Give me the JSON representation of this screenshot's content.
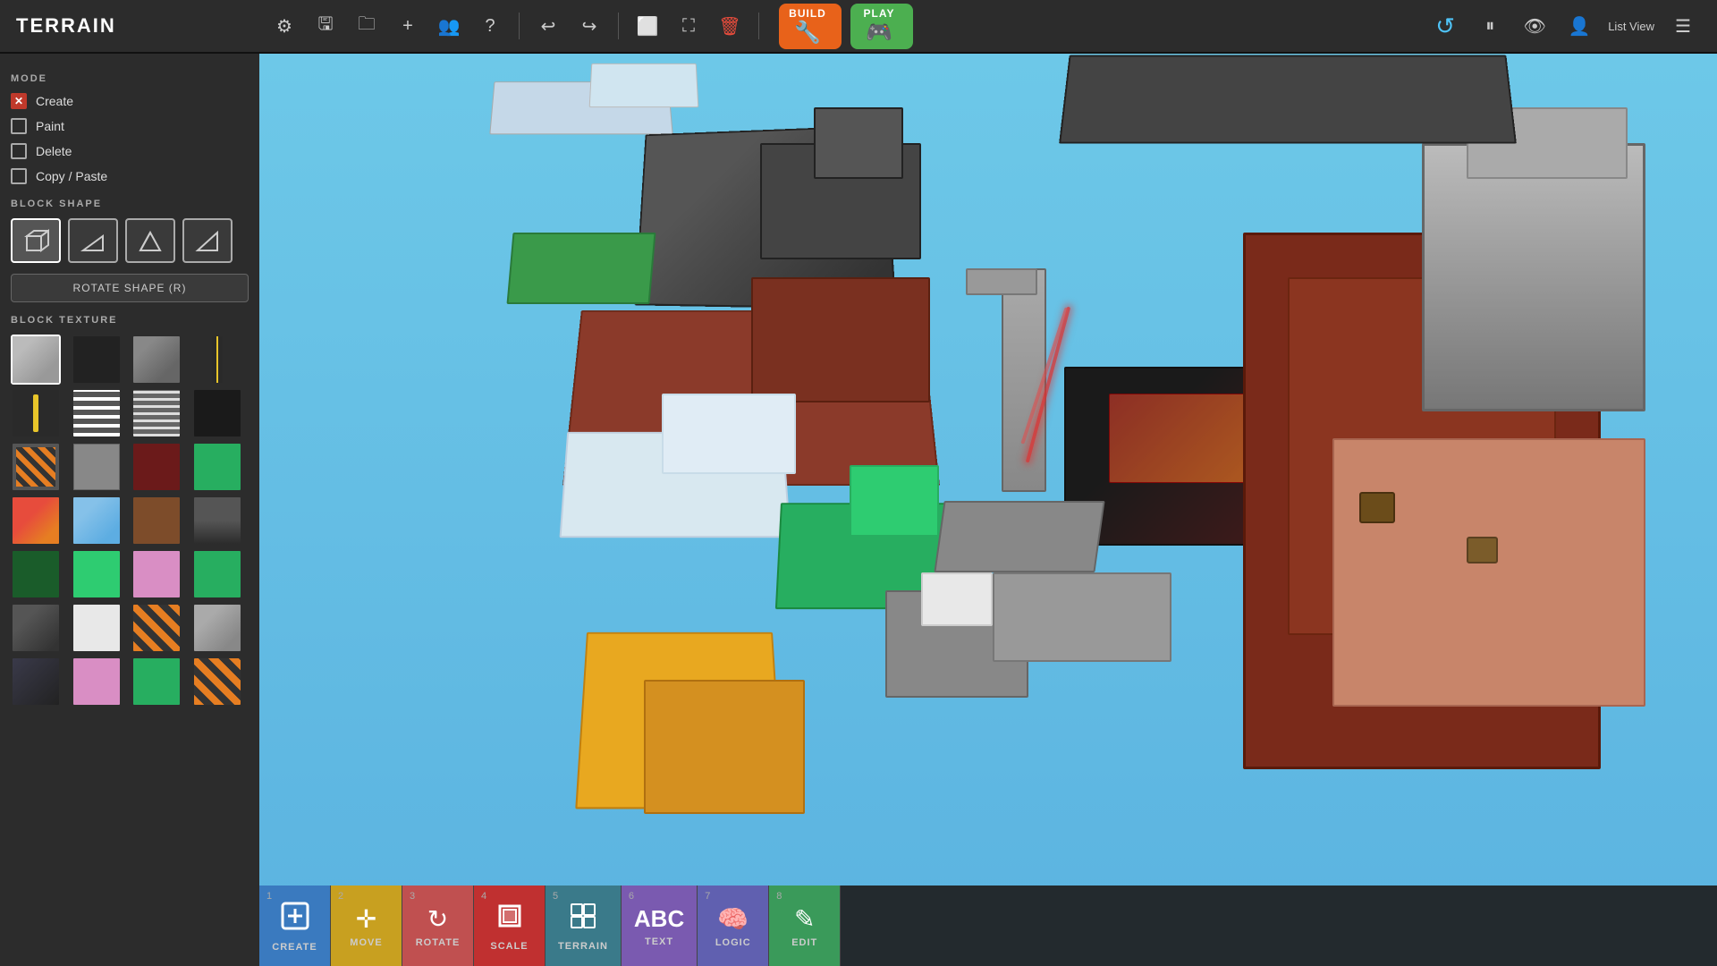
{
  "app": {
    "title": "TERRAIN"
  },
  "topbar": {
    "build_label": "BUILD",
    "play_label": "PLAY",
    "list_view_label": "List View",
    "tools": [
      {
        "name": "settings",
        "icon": "⚙",
        "label": "settings-icon"
      },
      {
        "name": "save",
        "icon": "💾",
        "label": "save-icon"
      },
      {
        "name": "folder",
        "icon": "📁",
        "label": "folder-icon"
      },
      {
        "name": "add",
        "icon": "➕",
        "label": "add-icon"
      },
      {
        "name": "team",
        "icon": "👥",
        "label": "team-icon"
      },
      {
        "name": "help",
        "icon": "❓",
        "label": "help-icon"
      },
      {
        "name": "undo",
        "icon": "↩",
        "label": "undo-icon"
      },
      {
        "name": "redo",
        "icon": "↪",
        "label": "redo-icon"
      },
      {
        "name": "copy-view",
        "icon": "⬜",
        "label": "copy-view-icon"
      },
      {
        "name": "resize",
        "icon": "⛶",
        "label": "resize-icon"
      },
      {
        "name": "trash",
        "icon": "🗑",
        "label": "trash-icon"
      }
    ],
    "right_tools": [
      {
        "name": "refresh",
        "icon": "↺",
        "label": "refresh-icon"
      },
      {
        "name": "pause",
        "icon": "⏸",
        "label": "pause-icon"
      },
      {
        "name": "eye",
        "icon": "👁",
        "label": "eye-icon"
      },
      {
        "name": "profile",
        "icon": "👤",
        "label": "profile-icon"
      }
    ]
  },
  "sidebar": {
    "mode_label": "MODE",
    "modes": [
      {
        "id": "create",
        "label": "Create",
        "active": true,
        "x_style": true
      },
      {
        "id": "paint",
        "label": "Paint",
        "active": false
      },
      {
        "id": "delete",
        "label": "Delete",
        "active": false
      },
      {
        "id": "copy-paste",
        "label": "Copy / Paste",
        "active": false
      }
    ],
    "block_shape_label": "BLOCK SHAPE",
    "shapes": [
      {
        "id": "cube",
        "icon": "⬛",
        "label": "Cube",
        "active": true
      },
      {
        "id": "slope",
        "icon": "◨",
        "label": "Slope",
        "active": false
      },
      {
        "id": "wedge",
        "icon": "◤",
        "label": "Wedge",
        "active": false
      },
      {
        "id": "corner",
        "icon": "△",
        "label": "Corner",
        "active": false
      }
    ],
    "rotate_label": "ROTATE SHAPE (R)",
    "block_texture_label": "BLOCK TEXTURE",
    "textures": [
      "t-gray-light",
      "t-dark",
      "t-gray-med",
      "t-yellow-stripe",
      "t-tall-yellow",
      "t-white-lines",
      "t-horizontal-lines",
      "t-dark2",
      "t-red-brick",
      "t-orange-warn",
      "t-cobble",
      "t-dark-red",
      "t-green",
      "t-lava",
      "t-ice",
      "t-brown",
      "t-mountain",
      "t-dark-green",
      "t-green2",
      "t-pink",
      "t-green3",
      "t-stone-dark",
      "t-snow",
      "t-striped-warn",
      "t-stone-light",
      "t-pink",
      "t-green3",
      "t-striped-warn"
    ]
  },
  "bottom_toolbar": {
    "tools": [
      {
        "num": "1",
        "icon": "⊞",
        "label": "CREATE",
        "class": "bt-create"
      },
      {
        "num": "2",
        "icon": "✛",
        "label": "MOVE",
        "class": "bt-move"
      },
      {
        "num": "3",
        "icon": "↻",
        "label": "ROTATE",
        "class": "bt-rotate"
      },
      {
        "num": "4",
        "icon": "⛓",
        "label": "SCALE",
        "class": "bt-scale"
      },
      {
        "num": "5",
        "icon": "⊞",
        "label": "TERRAIN",
        "class": "bt-terrain"
      },
      {
        "num": "6",
        "icon": "Ⓐ",
        "label": "TEXT",
        "class": "bt-text"
      },
      {
        "num": "7",
        "icon": "🧠",
        "label": "LOGIC",
        "class": "bt-logic"
      },
      {
        "num": "8",
        "icon": "✎",
        "label": "EDIT",
        "class": "bt-edit"
      }
    ]
  }
}
